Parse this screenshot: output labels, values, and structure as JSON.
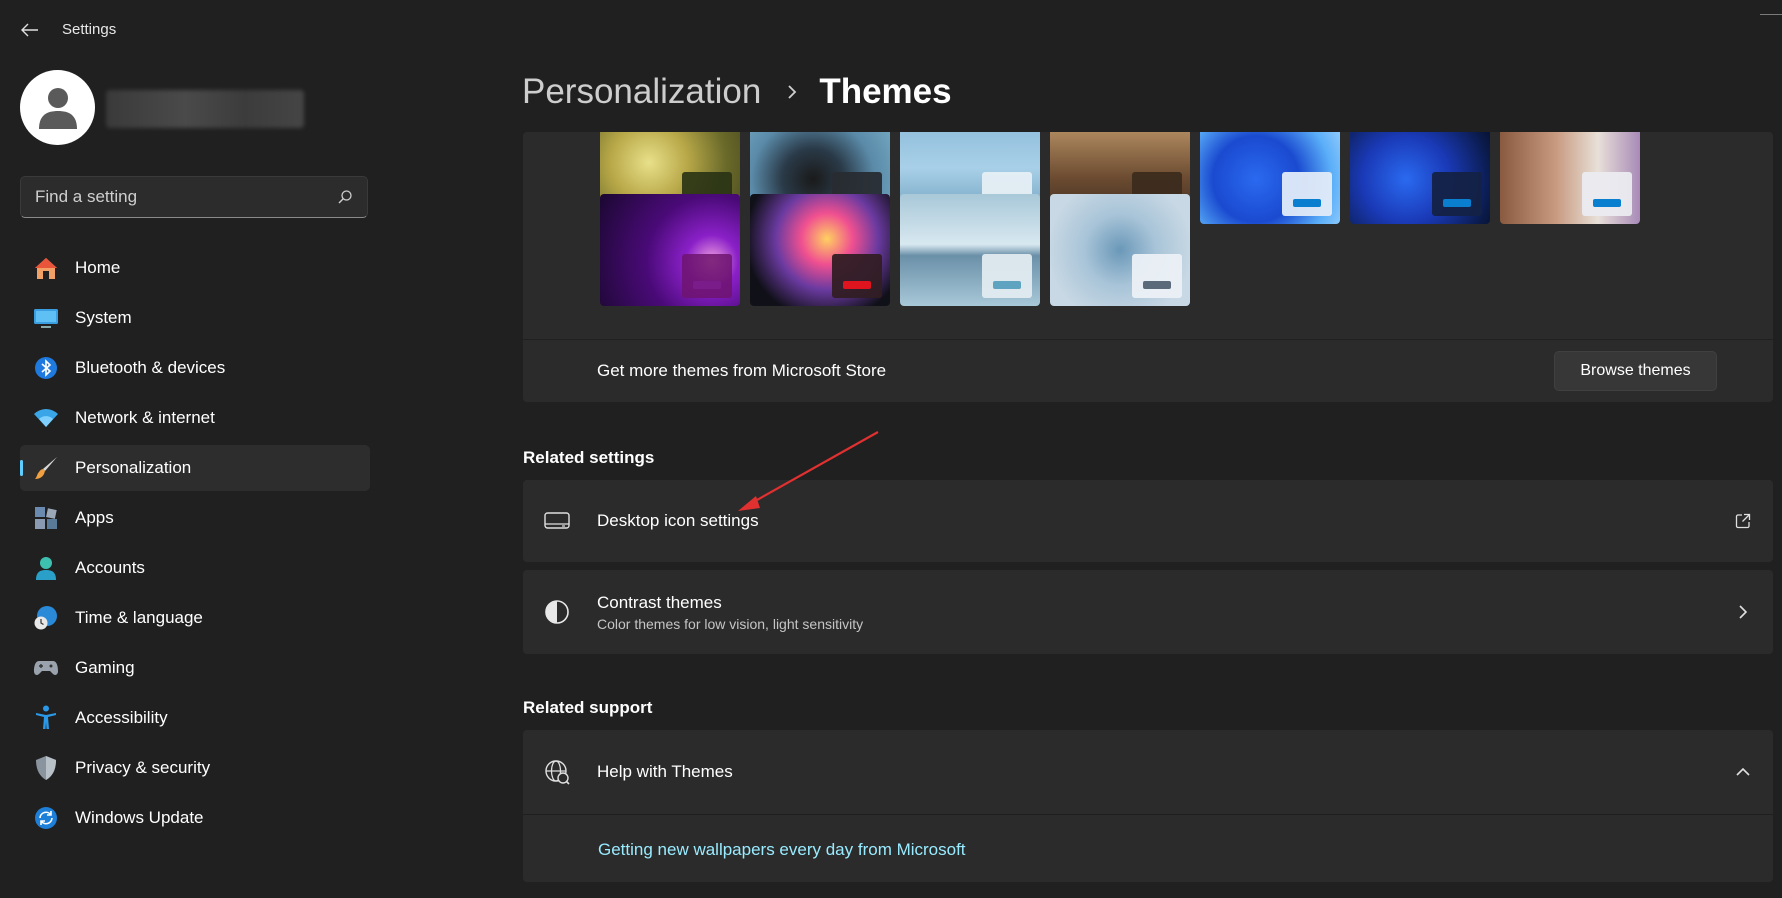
{
  "window": {
    "title": "Settings"
  },
  "search": {
    "placeholder": "Find a setting"
  },
  "sidebar": {
    "items": [
      {
        "label": "Home",
        "icon": "home-icon",
        "active": false
      },
      {
        "label": "System",
        "icon": "system-icon",
        "active": false
      },
      {
        "label": "Bluetooth & devices",
        "icon": "bluetooth-icon",
        "active": false
      },
      {
        "label": "Network & internet",
        "icon": "wifi-icon",
        "active": false
      },
      {
        "label": "Personalization",
        "icon": "brush-icon",
        "active": true
      },
      {
        "label": "Apps",
        "icon": "apps-icon",
        "active": false
      },
      {
        "label": "Accounts",
        "icon": "account-icon",
        "active": false
      },
      {
        "label": "Time & language",
        "icon": "clock-globe-icon",
        "active": false
      },
      {
        "label": "Gaming",
        "icon": "gamepad-icon",
        "active": false
      },
      {
        "label": "Accessibility",
        "icon": "accessibility-icon",
        "active": false
      },
      {
        "label": "Privacy & security",
        "icon": "shield-icon",
        "active": false
      },
      {
        "label": "Windows Update",
        "icon": "update-icon",
        "active": false
      }
    ]
  },
  "breadcrumb": {
    "parent": "Personalization",
    "current": "Themes"
  },
  "themes": {
    "accent_colors": [
      "#3fcf3f",
      "#e0141e",
      "#0a7fd0",
      "#2d6a8a",
      "#0a7fd0",
      "#0a7fd0",
      "#0a7fd0",
      "#7a1d8a",
      "#e0141e",
      "#5ea4c0",
      "#5a6a7a"
    ],
    "store_text": "Get more themes from Microsoft Store",
    "browse_label": "Browse themes"
  },
  "related_settings": {
    "title": "Related settings",
    "desktop_icons": {
      "title": "Desktop icon settings"
    },
    "contrast": {
      "title": "Contrast themes",
      "subtitle": "Color themes for low vision, light sensitivity"
    }
  },
  "related_support": {
    "title": "Related support",
    "help": {
      "title": "Help with Themes",
      "link": "Getting new wallpapers every day from Microsoft"
    }
  },
  "colors": {
    "accent": "#60cdff",
    "link": "#99ebff",
    "annotation": "#e03030"
  }
}
